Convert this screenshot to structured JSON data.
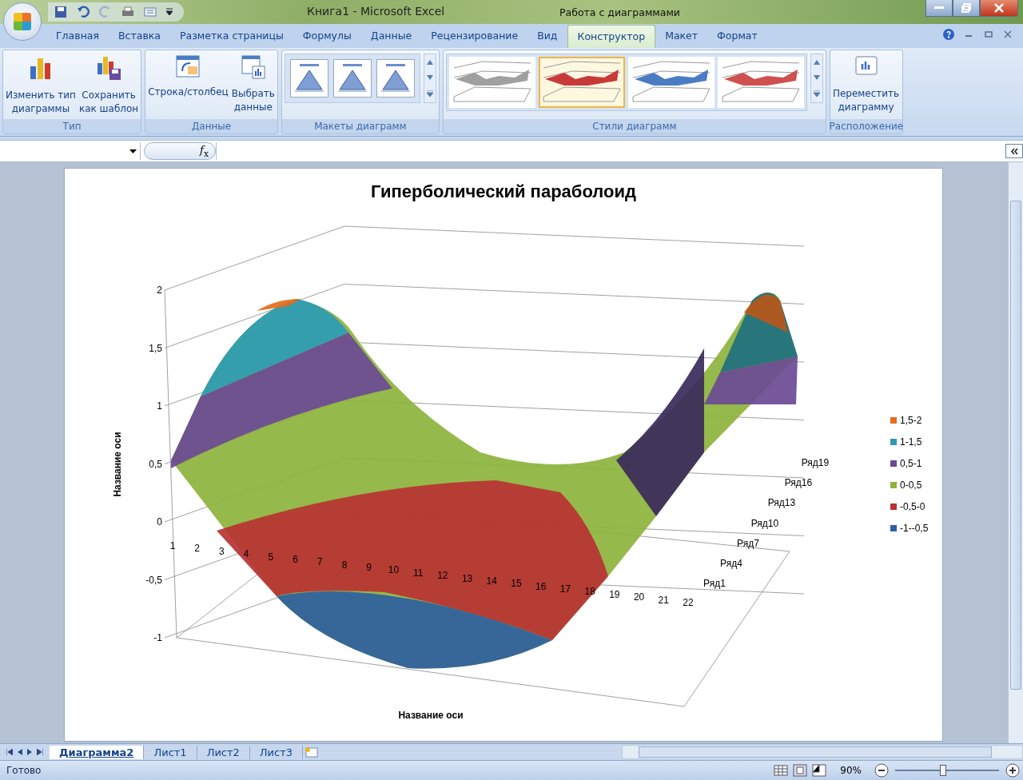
{
  "window": {
    "title": "Книга1 - Microsoft Excel",
    "context_title": "Работа с диаграммами"
  },
  "ribbon_tabs": [
    {
      "label": "Главная",
      "selected": false
    },
    {
      "label": "Вставка",
      "selected": false
    },
    {
      "label": "Разметка страницы",
      "selected": false
    },
    {
      "label": "Формулы",
      "selected": false
    },
    {
      "label": "Данные",
      "selected": false
    },
    {
      "label": "Рецензирование",
      "selected": false
    },
    {
      "label": "Вид",
      "selected": false
    },
    {
      "label": "Конструктор",
      "selected": true
    },
    {
      "label": "Макет",
      "selected": false
    },
    {
      "label": "Формат",
      "selected": false
    }
  ],
  "ribbon_groups": [
    {
      "label": "Тип",
      "kind": "buttons",
      "buttons": [
        {
          "label": "Изменить тип\nдиаграммы"
        },
        {
          "label": "Сохранить\nкак шаблон"
        }
      ]
    },
    {
      "label": "Данные",
      "kind": "buttons",
      "buttons": [
        {
          "label": "Строка/столбец"
        },
        {
          "label": "Выбрать\nданные"
        }
      ]
    },
    {
      "label": "Макеты диаграмм",
      "kind": "layouts"
    },
    {
      "label": "Стили диаграмм",
      "kind": "styles",
      "styles": [
        {
          "color": "#a0a0a0",
          "selected": false
        },
        {
          "color": "#c83a3a",
          "selected": true
        },
        {
          "color": "#4a7cc4",
          "selected": false
        },
        {
          "color": "#d05050",
          "selected": false
        }
      ]
    },
    {
      "label": "Расположение",
      "kind": "buttons",
      "buttons": [
        {
          "label": "Переместить\nдиаграмму"
        }
      ]
    }
  ],
  "chart": {
    "title": "Гиперболический параболоид",
    "y_axis_title": "Название оси",
    "x_axis_title": "Название оси",
    "y_ticks": [
      "2",
      "1,5",
      "1",
      "0,5",
      "0",
      "-0,5",
      "-1"
    ],
    "x_categories": [
      "1",
      "2",
      "3",
      "4",
      "5",
      "6",
      "7",
      "8",
      "9",
      "10",
      "11",
      "12",
      "13",
      "14",
      "15",
      "16",
      "17",
      "18",
      "19",
      "20",
      "21",
      "22"
    ],
    "series_labels": [
      "Ряд1",
      "Ряд4",
      "Ряд7",
      "Ряд10",
      "Ряд13",
      "Ряд16",
      "Ряд19"
    ],
    "legend": [
      {
        "label": "1,5-2",
        "color": "#e46c1e"
      },
      {
        "label": "1-1,5",
        "color": "#2b9bb5"
      },
      {
        "label": "0,5-1",
        "color": "#6b4a94"
      },
      {
        "label": "0-0,5",
        "color": "#8db33c"
      },
      {
        "label": "-0,5-0",
        "color": "#b83232"
      },
      {
        "label": "-1--0,5",
        "color": "#2e5f9e"
      }
    ]
  },
  "sheet_tabs": [
    {
      "label": "Диаграмма2",
      "selected": true
    },
    {
      "label": "Лист1",
      "selected": false
    },
    {
      "label": "Лист2",
      "selected": false
    },
    {
      "label": "Лист3",
      "selected": false
    }
  ],
  "status_bar": {
    "text": "Готово",
    "zoom": "90%",
    "level": 0.46
  },
  "formula_bar": {
    "function_label": "*f*$_{x}$"
  }
}
